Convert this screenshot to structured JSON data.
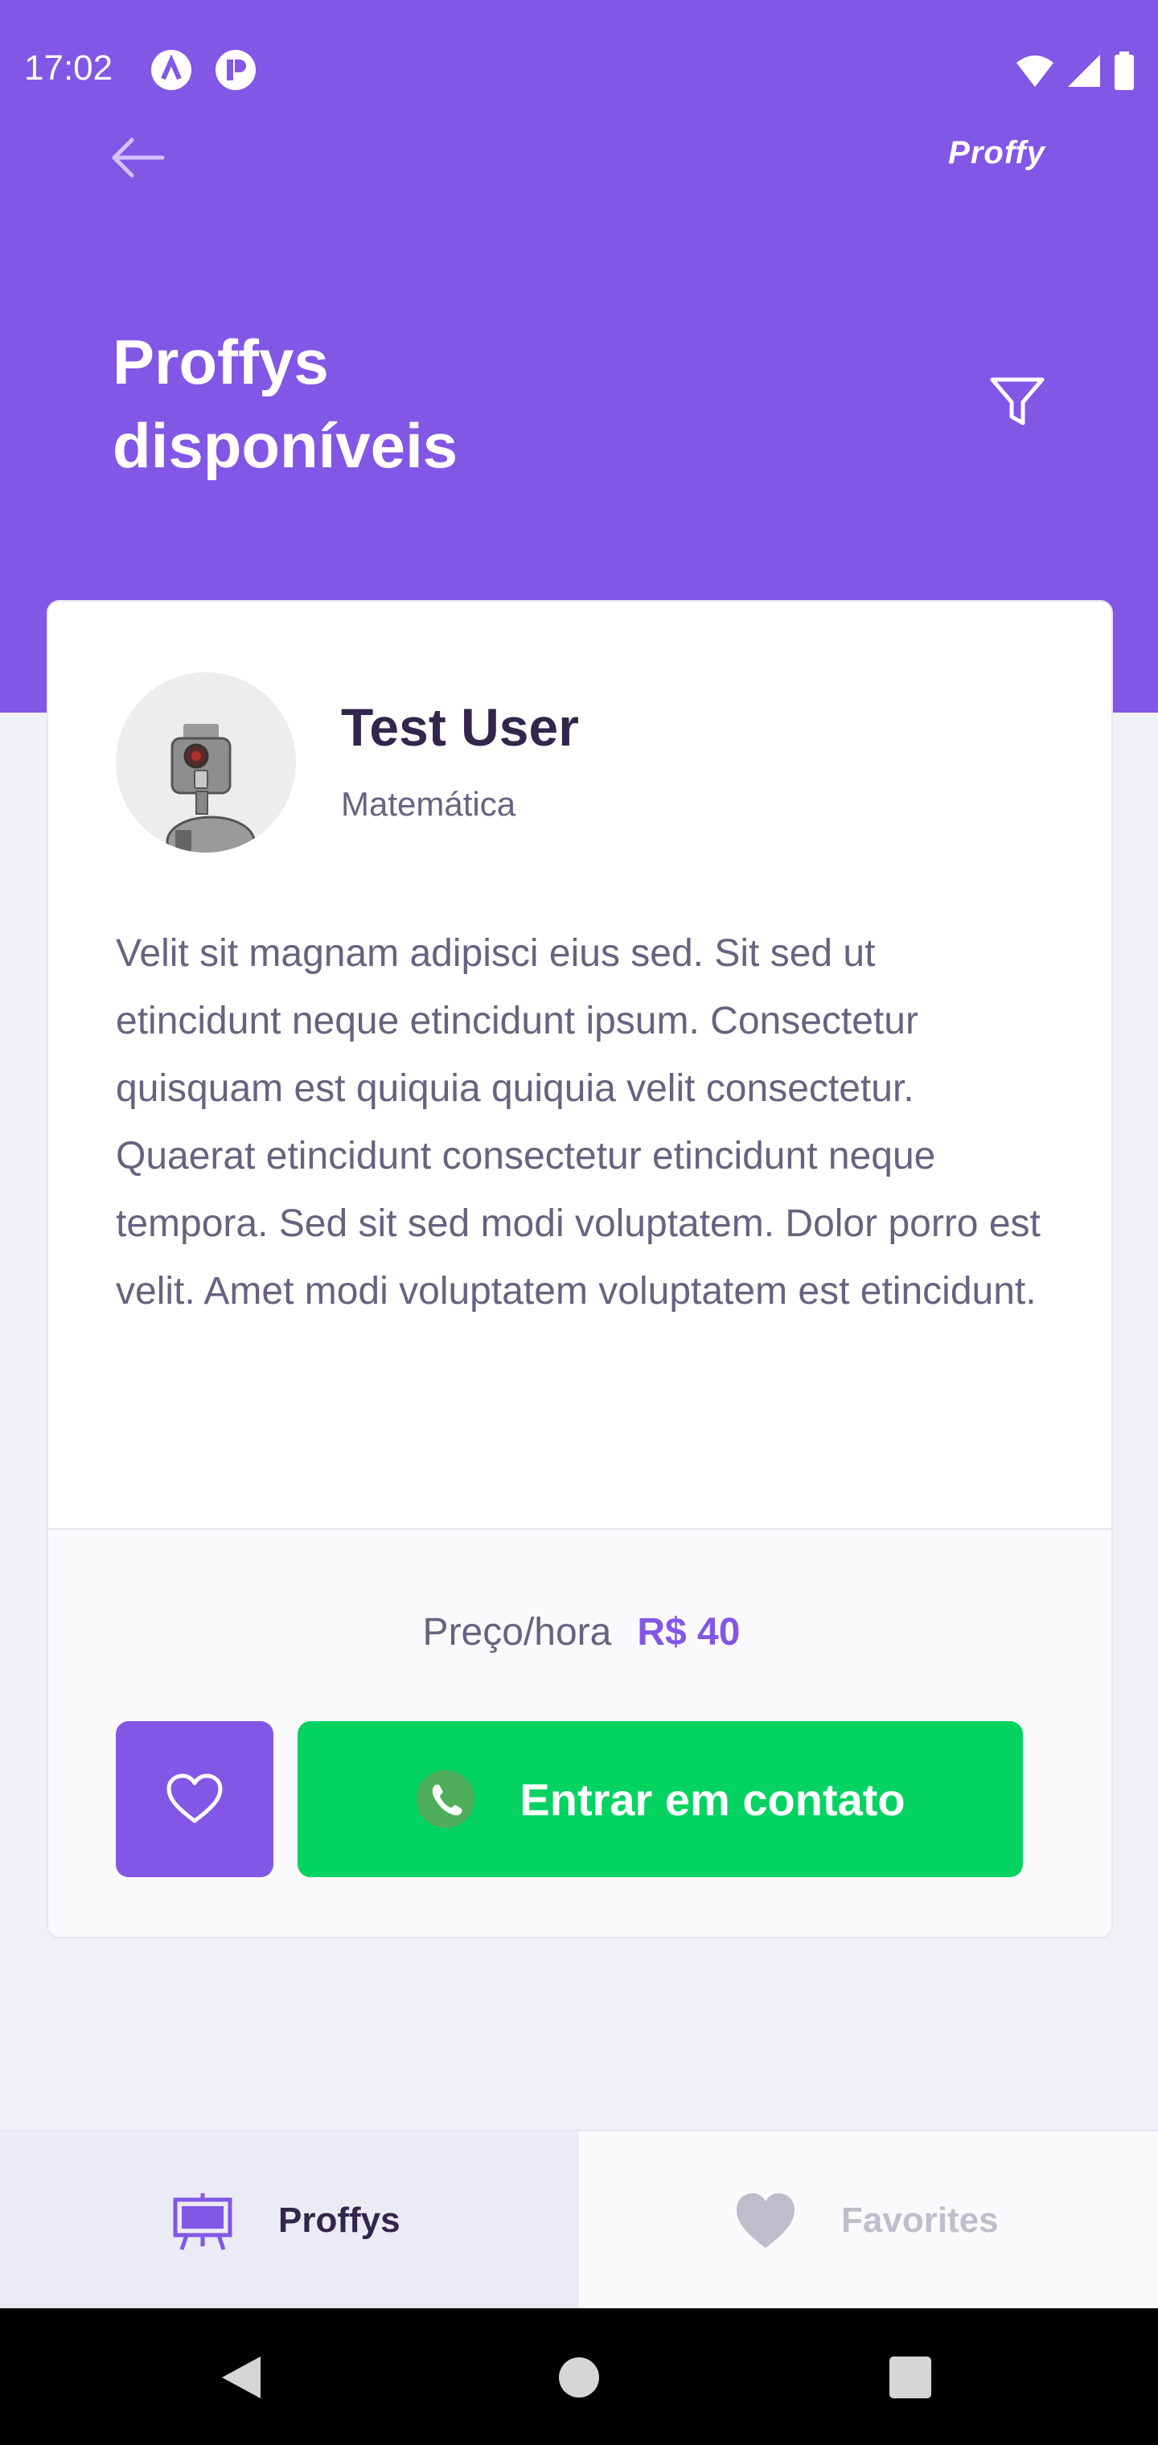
{
  "status_bar": {
    "time": "17:02"
  },
  "header": {
    "brand": "Proffy",
    "title_line1": "Proffys",
    "title_line2": "disponíveis"
  },
  "teacher": {
    "name": "Test User",
    "subject": "Matemática",
    "bio": "Velit sit magnam adipisci eius sed. Sit sed ut etincidunt neque etincidunt ipsum. Consectetur quisquam est quiquia quiquia velit consectetur. Quaerat etincidunt consectetur etincidunt neque tempora. Sed sit sed modi voluptatem. Dolor porro est velit. Amet modi voluptatem voluptatem est etincidunt.",
    "price_label": "Preço/hora",
    "price_value": "R$ 40",
    "contact_label": "Entrar em contato"
  },
  "tabs": [
    {
      "label": "Proffys",
      "icon": "easel-icon",
      "active": true
    },
    {
      "label": "Favorites",
      "icon": "heart-icon",
      "active": false
    }
  ],
  "colors": {
    "primary": "#8257E5",
    "whatsapp": "#04D361",
    "background": "#F0F0F7",
    "text_title": "#32264D",
    "text_base": "#6A6180"
  }
}
